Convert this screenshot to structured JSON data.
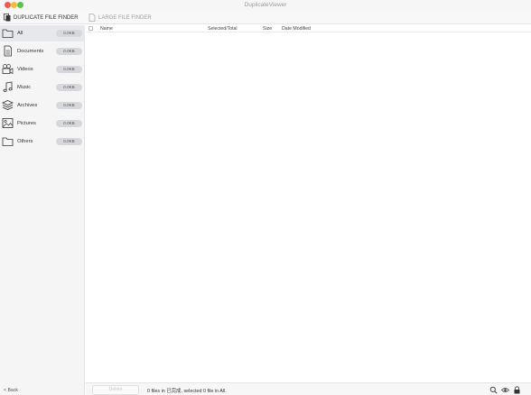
{
  "window": {
    "title": "DuplicateViewer"
  },
  "toolbar": {
    "tab_duplicate": "DUPLICATE FILE FINDER",
    "tab_large": "LARGE FILE FINDER"
  },
  "sidebar": {
    "items": [
      {
        "label": "All",
        "badge": "0.0KB",
        "icon": "folder-icon"
      },
      {
        "label": "Documents",
        "badge": "0.0KB",
        "icon": "document-icon"
      },
      {
        "label": "Videos",
        "badge": "0.0KB",
        "icon": "video-camera-icon"
      },
      {
        "label": "Music",
        "badge": "0.0KB",
        "icon": "music-note-icon"
      },
      {
        "label": "Archives",
        "badge": "0.0KB",
        "icon": "archive-layers-icon"
      },
      {
        "label": "Pictures",
        "badge": "0.0KB",
        "icon": "picture-icon"
      },
      {
        "label": "Others",
        "badge": "0.0KB",
        "icon": "folder-icon"
      }
    ],
    "back_label": "< Back"
  },
  "table": {
    "columns": [
      "Name",
      "Selected/Total",
      "Size",
      "Date Modified"
    ]
  },
  "statusbar": {
    "delete_label": "Delete",
    "status_text": "0 files in 已完成, selected 0 file in All."
  }
}
